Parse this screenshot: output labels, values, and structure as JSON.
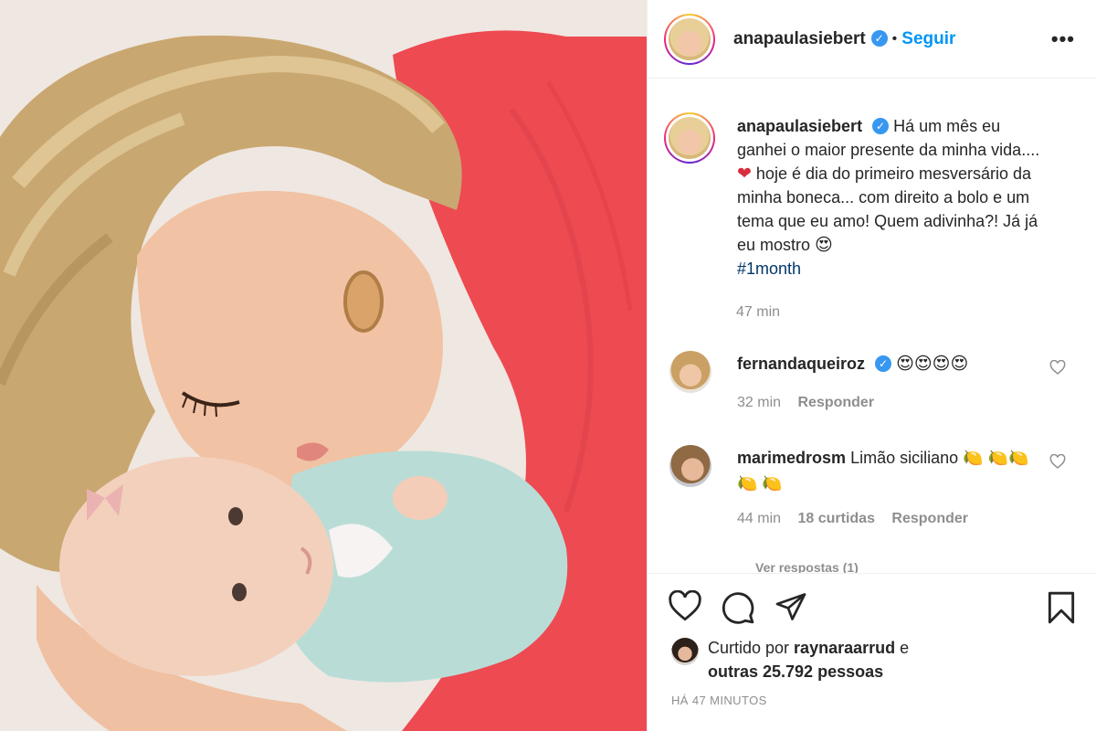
{
  "post": {
    "author": "anapaulasiebert",
    "follow_label": "Seguir",
    "separator": "•",
    "more_label": "•••",
    "verified_mark": "✓"
  },
  "caption": {
    "username": "anapaulasiebert",
    "text_part1": "Há um mês eu ganhei o maior presente da minha vida.... ",
    "heart_emoji": "❤",
    "text_part2": " hoje é dia do primeiro mesversário da minha boneca... com direito a bolo e um tema que eu amo! Quem adivinha?! Já já eu mostro ",
    "emoji_end": "😍",
    "hashtag": "#1month",
    "time": "47 min"
  },
  "comments": [
    {
      "username": "fernandaqueiroz",
      "verified": true,
      "text": "😍😍😍😍",
      "time": "32 min",
      "likes": "",
      "reply_label": "Responder"
    },
    {
      "username": "marimedrosm",
      "verified": false,
      "text": "Limão siciliano 🍋 🍋🍋🍋 🍋",
      "time": "44 min",
      "likes": "18 curtidas",
      "reply_label": "Responder"
    }
  ],
  "view_replies": "Ver respostas (1)",
  "likes": {
    "prefix": "Curtido por ",
    "user": "raynaraarrud",
    "middle": " e",
    "others": "outras 25.792 pessoas"
  },
  "posted_ago": "Há 47 minutos",
  "icons": {
    "like": "heart-outline-icon",
    "comment": "comment-bubble-icon",
    "share": "paper-plane-icon",
    "save": "bookmark-icon"
  },
  "colors": {
    "link_blue": "#0095f6",
    "verified_blue": "#3897f0",
    "hashtag": "#00376b",
    "muted": "#8e8e8e",
    "sweater_red": "#ee4a52"
  }
}
